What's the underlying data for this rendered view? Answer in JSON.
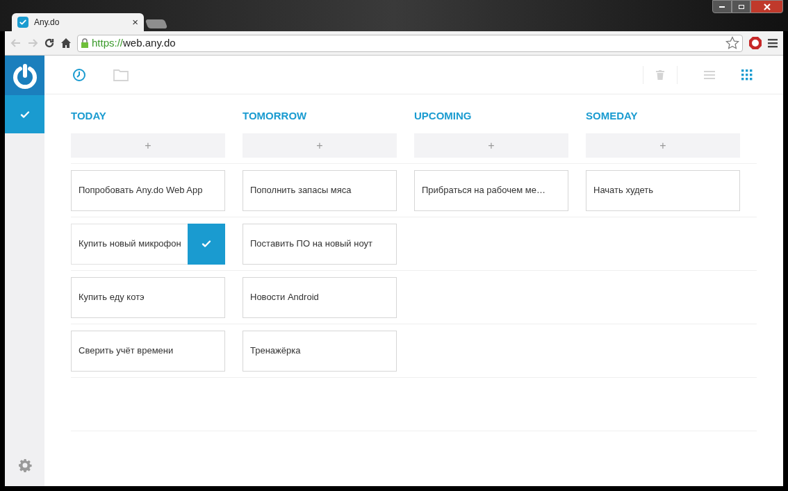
{
  "browser": {
    "tab_title": "Any.do",
    "tab_close": "×",
    "url_scheme": "https://",
    "url_rest": "web.any.do"
  },
  "sidebar": {
    "items": [
      {
        "kind": "tasks",
        "selected": true
      }
    ]
  },
  "toolbar": {
    "nav": [
      {
        "kind": "clock",
        "selected": true
      },
      {
        "kind": "folder",
        "selected": false
      }
    ],
    "views": [
      {
        "kind": "list",
        "selected": false
      },
      {
        "kind": "grid",
        "selected": true
      }
    ]
  },
  "add_label": "+",
  "columns": [
    {
      "title": "TODAY",
      "tasks": [
        {
          "text": "Попробовать Any.do Web App",
          "selected": false
        },
        {
          "text": "Купить новый микрофон",
          "selected": true
        },
        {
          "text": "Купить еду котэ",
          "selected": false
        },
        {
          "text": "Сверить учёт времени",
          "selected": false
        }
      ]
    },
    {
      "title": "TOMORROW",
      "tasks": [
        {
          "text": "Пополнить запасы мяса",
          "selected": false
        },
        {
          "text": "Поставить ПО на новый ноут",
          "selected": false
        },
        {
          "text": "Новости Android",
          "selected": false
        },
        {
          "text": "Тренажёрка",
          "selected": false
        }
      ]
    },
    {
      "title": "UPCOMING",
      "tasks": [
        {
          "text": "Прибраться на рабочем ме…",
          "selected": false
        }
      ]
    },
    {
      "title": "SOMEDAY",
      "tasks": [
        {
          "text": "Начать худеть",
          "selected": false
        }
      ]
    }
  ]
}
